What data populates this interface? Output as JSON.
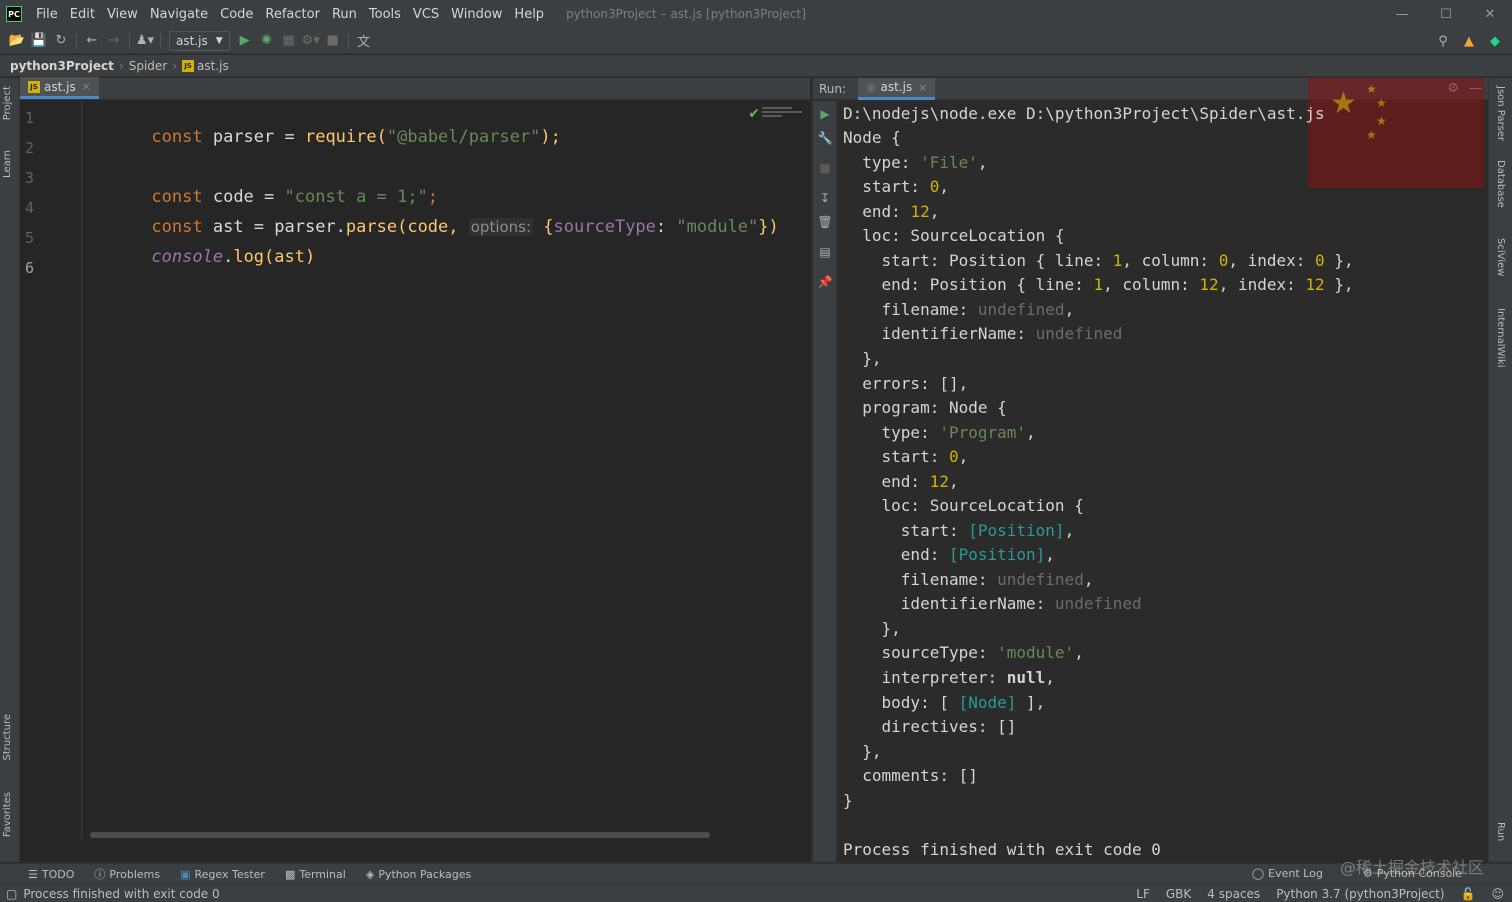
{
  "app": {
    "logo_text": "PC",
    "window_title": "python3Project – ast.js [python3Project]",
    "menu": [
      "File",
      "Edit",
      "View",
      "Navigate",
      "Code",
      "Refactor",
      "Run",
      "Tools",
      "VCS",
      "Window",
      "Help"
    ]
  },
  "toolbar": {
    "run_config": "ast.js",
    "icons": [
      "open-folder-icon",
      "save-icon",
      "sync-icon",
      "back-icon",
      "forward-icon",
      "user-icon",
      "run-icon",
      "debug-icon",
      "coverage-icon",
      "profile-icon",
      "stop-icon",
      "translate-icon"
    ]
  },
  "breadcrumb": {
    "project": "python3Project",
    "folder": "Spider",
    "file": "ast.js"
  },
  "left_strip": {
    "project": "Project",
    "learn": "Learn",
    "structure": "Structure",
    "favorites": "Favorites"
  },
  "right_strip": {
    "json_parser": "Json Parser",
    "database": "Database",
    "sciview": "SciView",
    "internalwiki": "InternalWiki",
    "run": "Run"
  },
  "editor": {
    "tab": "ast.js",
    "tab_badge": "JS",
    "line_numbers": [
      "1",
      "2",
      "3",
      "4",
      "5",
      "6"
    ],
    "code": {
      "l1": {
        "kw": "const",
        "name": " parser = ",
        "fn": "require",
        "open": "(",
        "str": "\"@babel/parser\"",
        "close": ");"
      },
      "l3": {
        "kw": "const",
        "name": " code = ",
        "str": "\"const a = 1;\"",
        "close": ";"
      },
      "l4": {
        "kw": "const",
        "name": " ast = parser.",
        "fn": "parse",
        "open": "(code, ",
        "hint": "options:",
        "brace": " {",
        "prop": "sourceType",
        "colon": ": ",
        "str": "\"module\"",
        "close": "})"
      },
      "l5": {
        "obj": "console",
        "dot": ".",
        "fn": "log",
        "rest": "(ast)"
      }
    }
  },
  "run_panel": {
    "label": "Run:",
    "tab": "ast.js",
    "output": {
      "cmd": "D:\\nodejs\\node.exe D:\\python3Project\\Spider\\ast.js",
      "node_open": "Node {",
      "type_key": "  type: ",
      "type_val": "'File'",
      "start_key": "  start: ",
      "start_val": "0",
      "end_key": "  end: ",
      "end_val": "12",
      "loc_open": "  loc: SourceLocation {",
      "loc_start_a": "    start: Position { line: ",
      "loc_start_line": "1",
      "loc_start_b": ", column: ",
      "loc_start_col": "0",
      "loc_start_c": ", index: ",
      "loc_start_idx": "0",
      "loc_start_d": " },",
      "loc_end_a": "    end: Position { line: ",
      "loc_end_line": "1",
      "loc_end_b": ", column: ",
      "loc_end_col": "12",
      "loc_end_c": ", index: ",
      "loc_end_idx": "12",
      "loc_end_d": " },",
      "filename_key": "    filename: ",
      "undefined": "undefined",
      "ident_key": "    identifierName: ",
      "close_brace_comma": "  },",
      "errors": "  errors: [],",
      "program_open": "  program: Node {",
      "p_type_key": "    type: ",
      "p_type_val": "'Program'",
      "p_start_key": "    start: ",
      "p_start_val": "0",
      "p_end_key": "    end: ",
      "p_end_val": "12",
      "p_loc_open": "    loc: SourceLocation {",
      "p_loc_start_key": "      start: ",
      "position_link": "[Position]",
      "p_loc_end_key": "      end: ",
      "p_filename_key": "      filename: ",
      "p_ident_key": "      identifierName: ",
      "p_loc_close": "    },",
      "p_source_key": "    sourceType: ",
      "p_source_val": "'module'",
      "p_interp_key": "    interpreter: ",
      "null": "null",
      "p_body_key": "    body: [ ",
      "node_link": "[Node]",
      "p_body_end": " ],",
      "p_directives": "    directives: []",
      "program_close": "  },",
      "comments": "  comments: []",
      "node_close": "}",
      "finished": "Process finished with exit code 0"
    }
  },
  "bottom_tools": [
    "TODO",
    "Problems",
    "Regex Tester",
    "Terminal",
    "Python Packages"
  ],
  "bottom_right_tools": [
    "Event Log",
    "Python Console"
  ],
  "status": {
    "message": "Process finished with exit code 0",
    "line_sep": "LF",
    "encoding": "GBK",
    "indent": "4 spaces",
    "interpreter": "Python 3.7 (python3Project)"
  },
  "watermark": "@稀土掘金技术社区",
  "colors": {
    "keyword": "#cc7832",
    "string": "#6a8759",
    "function": "#ffc66d",
    "number": "#d4b106",
    "link": "#299999",
    "accent": "#4a88c7"
  }
}
